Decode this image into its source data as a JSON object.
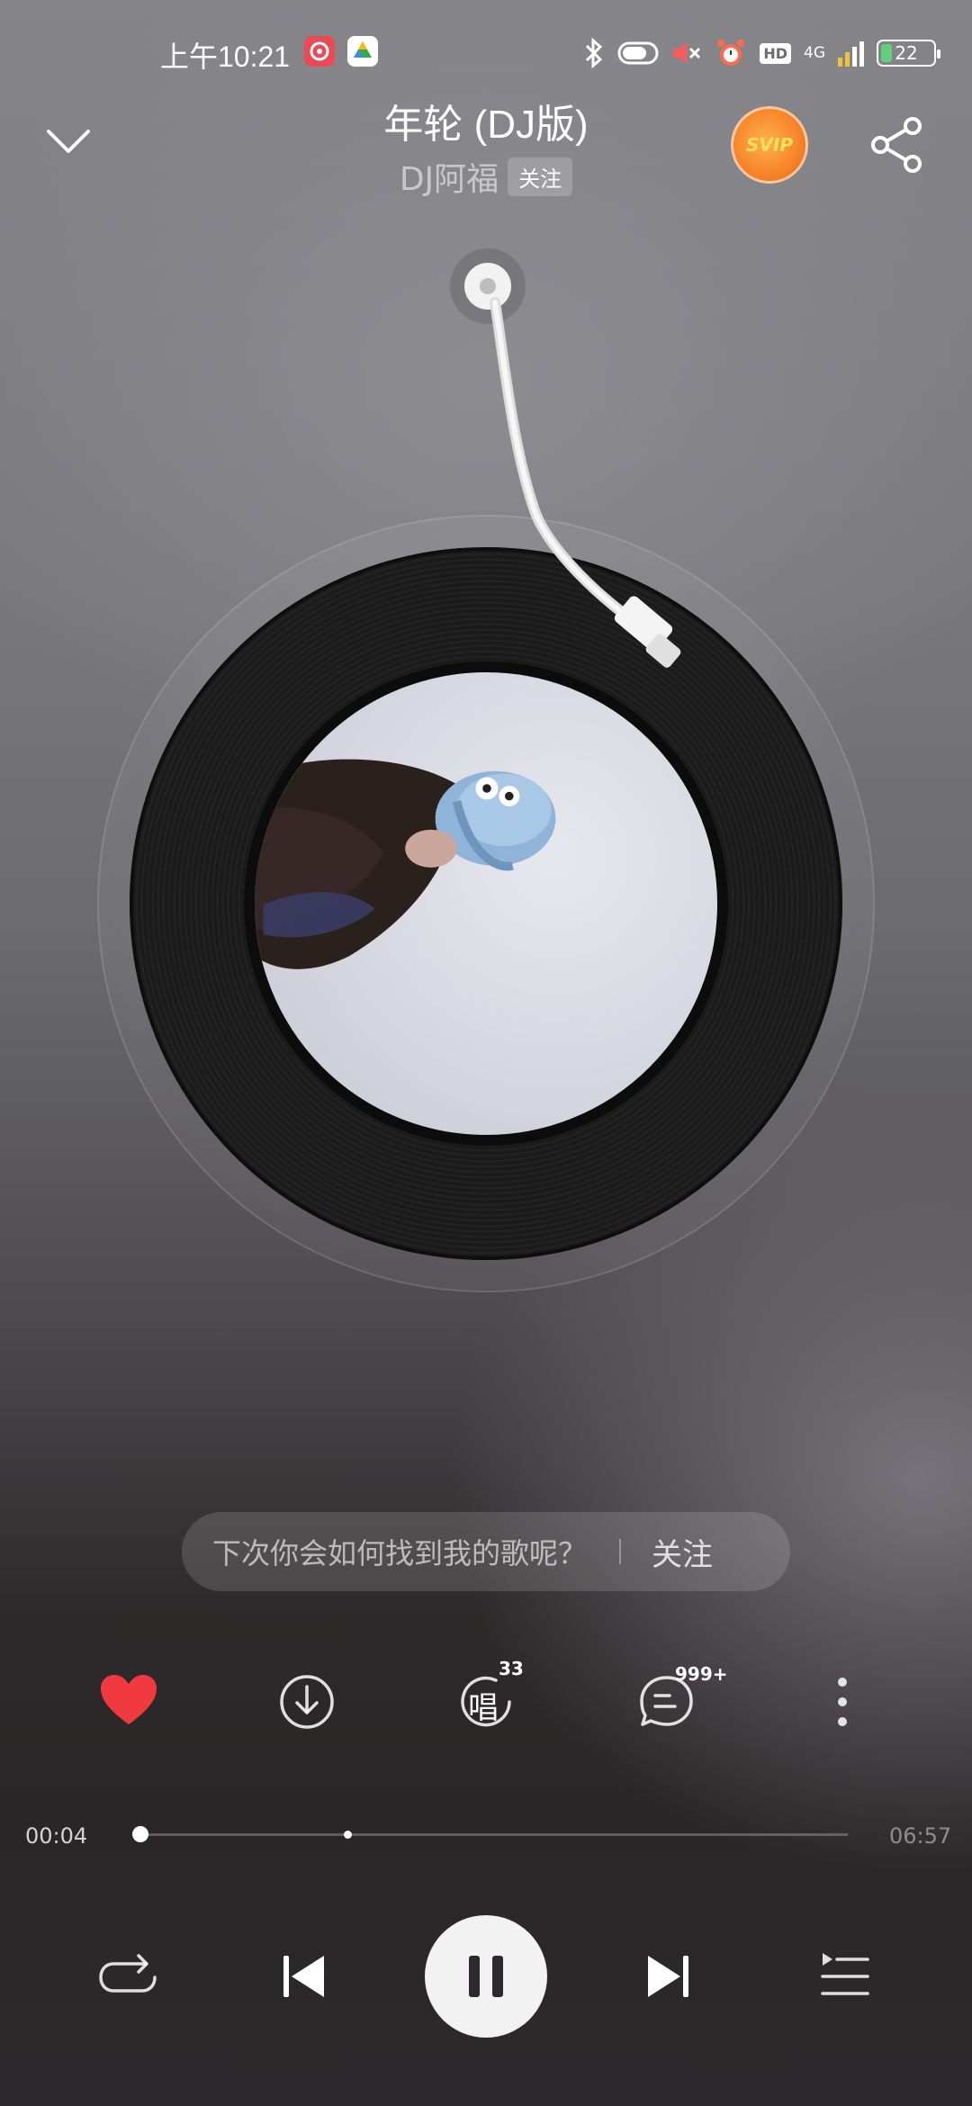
{
  "status_bar": {
    "time": "上午10:21",
    "hd_label": "HD",
    "network": "4G",
    "battery": "22",
    "battery_level": 0.22
  },
  "header": {
    "title": "年轮 (DJ版)",
    "artist": "DJ阿福",
    "follow_label": "关注",
    "vip_label": "SVIP"
  },
  "prompt_bar": {
    "question": "下次你会如何找到我的歌呢？",
    "follow_label": "关注"
  },
  "actions": {
    "sing_count": "33",
    "comment_count": "999+",
    "sing_glyph": "唱"
  },
  "player": {
    "current_time": "00:04",
    "total_time": "06:57",
    "progress": 0.0096,
    "buffered": 0.3
  },
  "icons": {
    "back": "chevron-down-icon",
    "share": "share-icon",
    "like": "heart-icon",
    "download": "download-icon",
    "sing": "sing-icon",
    "comment": "comment-icon",
    "more": "more-vertical-icon",
    "repeat": "repeat-icon",
    "previous": "skip-previous-icon",
    "pause": "pause-icon",
    "next": "skip-next-icon",
    "playlist": "playlist-icon"
  },
  "colors": {
    "like": "#f03a3f",
    "vip": "#f7842a"
  }
}
